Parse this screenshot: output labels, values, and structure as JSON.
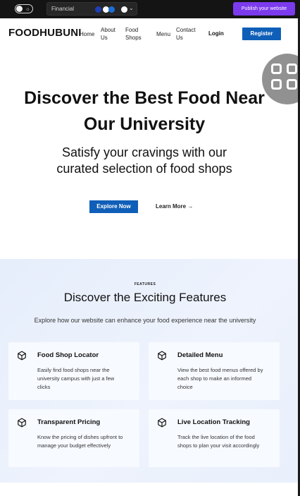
{
  "editor": {
    "theme_name": "Financial",
    "publish_label": "Publish your website",
    "toggle_sun": "☼",
    "chevron": "⌄"
  },
  "nav": {
    "logo": "FOODHUBUNI",
    "links": [
      "Home",
      "About Us",
      "Food Shops",
      "Menu",
      "Contact Us"
    ],
    "login": "Login",
    "register": "Register"
  },
  "hero": {
    "title": "Discover the Best Food Near Our University",
    "subtitle": "Satisfy your cravings with our curated selection of food shops",
    "explore": "Explore Now",
    "learn_more": "Learn More →"
  },
  "features": {
    "eyebrow": "FEATURES",
    "title": "Discover the Exciting Features",
    "description": "Explore how our website can enhance your food experience near the university",
    "cards": [
      {
        "title": "Food Shop Locator",
        "description": "Easily find food shops near the university campus with just a few clicks",
        "icon": "box-icon"
      },
      {
        "title": "Detailed Menu",
        "description": "View the best food menus offered by each shop to make an informed choice",
        "icon": "box-icon"
      },
      {
        "title": "Transparent Pricing",
        "description": "Know the pricing of dishes upfront to manage your budget effectively",
        "icon": "box-icon"
      },
      {
        "title": "Live Location Tracking",
        "description": "Track the live location of the food shops to plan your visit accordingly",
        "icon": "box-icon"
      }
    ]
  },
  "colors": {
    "primary": "#0f5fb8",
    "publish": "#7c3aed",
    "editor_bar": "#141414",
    "features_bg": "#e9f0fb"
  }
}
